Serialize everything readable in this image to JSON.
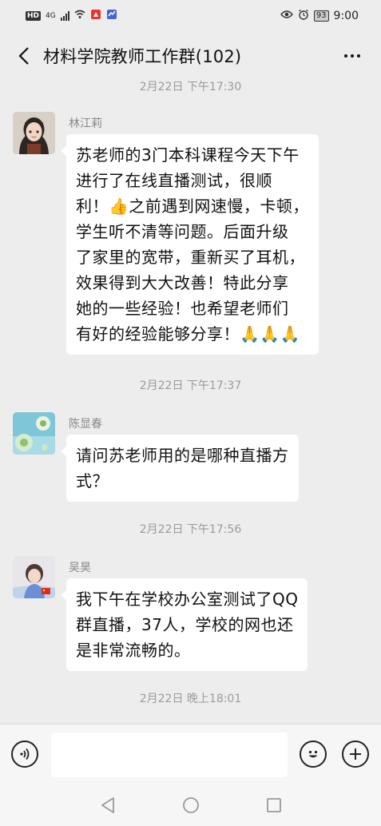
{
  "status_bar": {
    "hd": "HD",
    "network": "4G",
    "battery": "93",
    "time": "9:00"
  },
  "header": {
    "title": "材料学院教师工作群(102)",
    "back_icon": "chevron-left-icon",
    "more_icon": "more-dots-icon"
  },
  "messages": [
    {
      "timestamp": "2月22日 下午17:30",
      "sender": "林江莉",
      "lines": [
        "苏老师的3门本科课程今天下午",
        "进行了在线直播测试，很顺",
        "利！👍之前遇到网速慢，卡顿，",
        "学生听不清等问题。后面升级",
        "了家里的宽带，重新买了耳机，",
        "效果得到大大改善！特此分享",
        "她的一些经验！也希望老师们",
        "有好的经验能够分享！🙏🙏🙏"
      ]
    },
    {
      "timestamp": "2月22日 下午17:37",
      "sender": "陈显春",
      "lines": [
        "请问苏老师用的是哪种直播方",
        "式？"
      ]
    },
    {
      "timestamp": "2月22日 下午17:56",
      "sender": "吴昊",
      "lines": [
        "我下午在学校办公室测试了QQ",
        "群直播，37人，学校的网也还",
        "是非常流畅的。"
      ]
    }
  ],
  "last_timestamp": "2月22日 晚上18:01",
  "input_bar": {
    "voice_icon": "voice-icon",
    "emoji_icon": "emoji-icon",
    "plus_icon": "plus-icon"
  },
  "nav": {
    "back_icon": "nav-back-icon",
    "home_icon": "nav-home-icon",
    "recents_icon": "nav-recents-icon"
  }
}
